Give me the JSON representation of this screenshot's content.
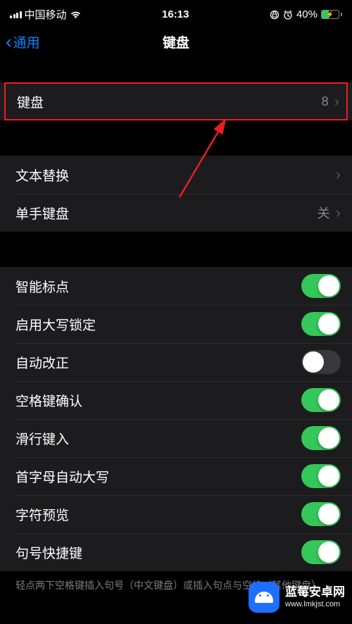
{
  "status_bar": {
    "carrier": "中国移动",
    "time": "16:13",
    "battery_percent": "40%"
  },
  "nav": {
    "back_label": "通用",
    "title": "键盘"
  },
  "groups": {
    "g1": {
      "keyboards": {
        "label": "键盘",
        "value": "8"
      }
    },
    "g2": {
      "text_replace": {
        "label": "文本替换"
      },
      "one_handed": {
        "label": "单手键盘",
        "value": "关"
      }
    },
    "g3": {
      "smart_punct": {
        "label": "智能标点",
        "on": true
      },
      "caps_lock": {
        "label": "启用大写锁定",
        "on": true
      },
      "auto_correct": {
        "label": "自动改正",
        "on": false
      },
      "space_confirm": {
        "label": "空格键确认",
        "on": true
      },
      "slide_input": {
        "label": "滑行键入",
        "on": true
      },
      "auto_cap": {
        "label": "首字母自动大写",
        "on": true
      },
      "char_preview": {
        "label": "字符预览",
        "on": true
      },
      "period_shortcut": {
        "label": "句号快捷键",
        "on": true
      }
    }
  },
  "footer": "轻点两下空格键插入句号（中文键盘）或插入句点与空格（其他键盘）。",
  "watermark": {
    "title": "蓝莓安卓网",
    "url": "www.lmkjst.com"
  }
}
